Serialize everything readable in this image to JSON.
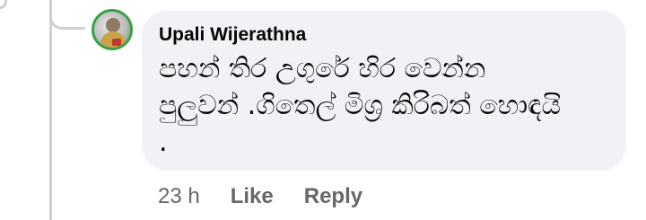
{
  "comment": {
    "author": "Upali Wijerathna",
    "text": "පහන් තිර උගුරේ හිර වෙන්න පුලුවන් .ගිතෙල් මිශ්‍ර කිරිබත් හොඳයි .",
    "timestamp": "23 h",
    "actions": {
      "like": "Like",
      "reply": "Reply"
    }
  },
  "colors": {
    "bubble_background": "#f0f2f5",
    "secondary_text": "#65676b",
    "thread_line": "#ced0d4",
    "avatar_ring": "#3aa14a"
  }
}
